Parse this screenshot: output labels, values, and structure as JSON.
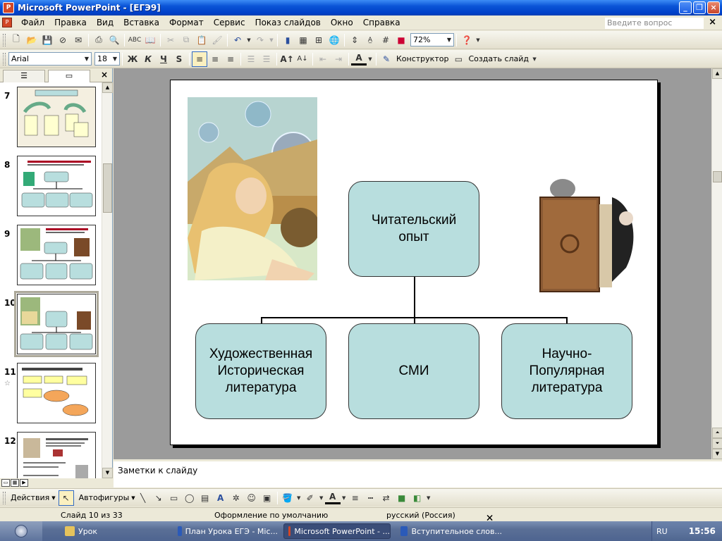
{
  "window": {
    "title": "Microsoft PowerPoint - [ЕГЭ9]",
    "app_icon": "powerpoint-icon"
  },
  "menu": {
    "items": [
      "Файл",
      "Правка",
      "Вид",
      "Вставка",
      "Формат",
      "Сервис",
      "Показ слайдов",
      "Окно",
      "Справка"
    ],
    "ask_placeholder": "Введите вопрос"
  },
  "toolbar": {
    "zoom": "72%",
    "font": "Arial",
    "font_size": "18",
    "bold": "Ж",
    "italic": "К",
    "underline": "Ч",
    "shadow": "S",
    "designer": "Конструктор",
    "new_slide": "Создать слайд"
  },
  "slides_pane": {
    "tab_outline_icon": "outline-icon",
    "tab_slides_icon": "slides-icon",
    "thumbnails": [
      {
        "number": "7"
      },
      {
        "number": "8"
      },
      {
        "number": "9"
      },
      {
        "number": "10",
        "selected": true
      },
      {
        "number": "11"
      },
      {
        "number": "12"
      }
    ]
  },
  "slide": {
    "root_node": "Читательский опыт",
    "children": [
      "Художественная Историческая литература",
      "СМИ",
      "Научно-Популярная литература"
    ]
  },
  "notes": {
    "placeholder": "Заметки к слайду"
  },
  "drawing_toolbar": {
    "actions": "Действия",
    "autoshapes": "Автофигуры"
  },
  "status": {
    "slide": "Слайд 10 из 33",
    "design": "Оформление по умолчанию",
    "language": "русский (Россия)"
  },
  "taskbar": {
    "tasks": [
      {
        "label": "Урок",
        "icon": "folder-icon"
      },
      {
        "label": "План Урока ЕГЭ - Mic...",
        "icon": "word-icon"
      },
      {
        "label": "Microsoft PowerPoint - ...",
        "icon": "powerpoint-icon",
        "active": true
      },
      {
        "label": "Вступительное слов...",
        "icon": "word-icon"
      }
    ],
    "lang": "RU",
    "time": "15:56"
  },
  "colors": {
    "node_fill": "#b8dede",
    "titlebar": "#0a53d6",
    "taskbar": "#5a6f96"
  }
}
